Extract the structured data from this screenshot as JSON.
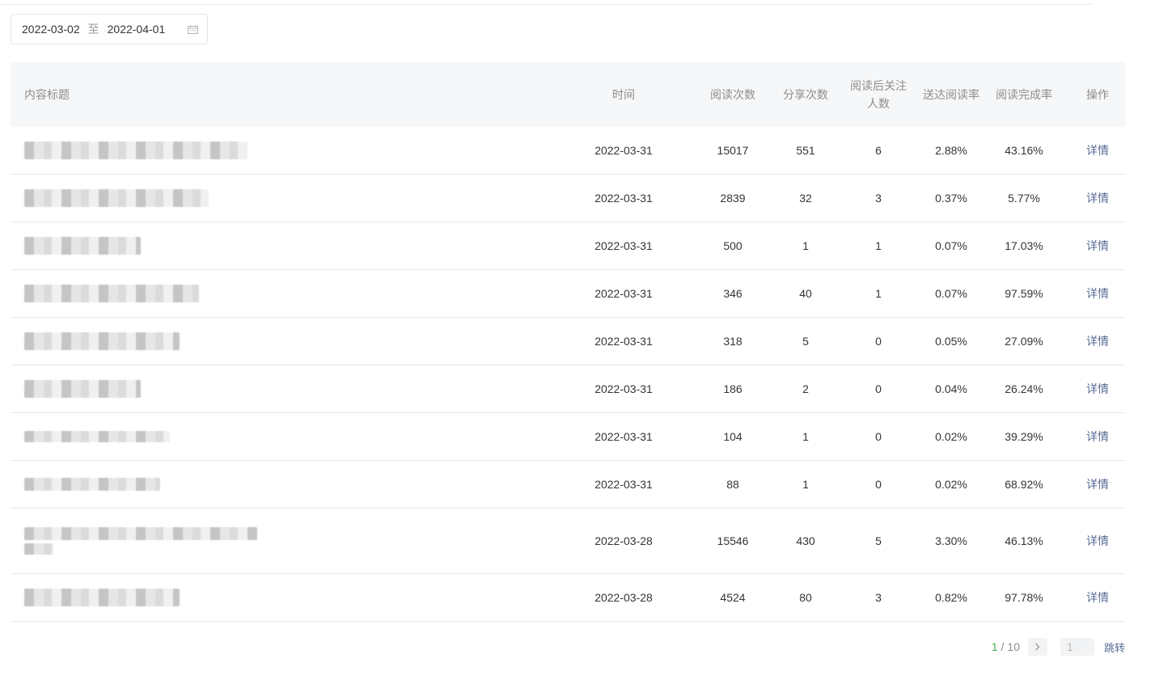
{
  "filter": {
    "start_date": "2022-03-02",
    "separator": "至",
    "end_date": "2022-04-01",
    "icon": "calendar-icon"
  },
  "table": {
    "headers": {
      "title": "内容标题",
      "time": "时间",
      "reads": "阅读次数",
      "shares": "分享次数",
      "follow_line1": "阅读后关注",
      "follow_line2": "人数",
      "delivery_rate": "送达阅读率",
      "completion_rate": "阅读完成率",
      "action": "操作"
    },
    "rows": [
      {
        "time": "2022-03-31",
        "reads": "15017",
        "shares": "551",
        "follows": "6",
        "delivery_rate": "2.88%",
        "completion_rate": "43.16%",
        "action": "详情"
      },
      {
        "time": "2022-03-31",
        "reads": "2839",
        "shares": "32",
        "follows": "3",
        "delivery_rate": "0.37%",
        "completion_rate": "5.77%",
        "action": "详情"
      },
      {
        "time": "2022-03-31",
        "reads": "500",
        "shares": "1",
        "follows": "1",
        "delivery_rate": "0.07%",
        "completion_rate": "17.03%",
        "action": "详情"
      },
      {
        "time": "2022-03-31",
        "reads": "346",
        "shares": "40",
        "follows": "1",
        "delivery_rate": "0.07%",
        "completion_rate": "97.59%",
        "action": "详情"
      },
      {
        "time": "2022-03-31",
        "reads": "318",
        "shares": "5",
        "follows": "0",
        "delivery_rate": "0.05%",
        "completion_rate": "27.09%",
        "action": "详情"
      },
      {
        "time": "2022-03-31",
        "reads": "186",
        "shares": "2",
        "follows": "0",
        "delivery_rate": "0.04%",
        "completion_rate": "26.24%",
        "action": "详情"
      },
      {
        "time": "2022-03-31",
        "reads": "104",
        "shares": "1",
        "follows": "0",
        "delivery_rate": "0.02%",
        "completion_rate": "39.29%",
        "action": "详情"
      },
      {
        "time": "2022-03-31",
        "reads": "88",
        "shares": "1",
        "follows": "0",
        "delivery_rate": "0.02%",
        "completion_rate": "68.92%",
        "action": "详情"
      },
      {
        "time": "2022-03-28",
        "reads": "15546",
        "shares": "430",
        "follows": "5",
        "delivery_rate": "3.30%",
        "completion_rate": "46.13%",
        "action": "详情"
      },
      {
        "time": "2022-03-28",
        "reads": "4524",
        "shares": "80",
        "follows": "3",
        "delivery_rate": "0.82%",
        "completion_rate": "97.78%",
        "action": "详情"
      }
    ]
  },
  "pagination": {
    "current": "1",
    "separator": "/",
    "total": "10",
    "next_icon": "chevron-right-icon",
    "page_input_value": "1",
    "jump_label": "跳转"
  }
}
